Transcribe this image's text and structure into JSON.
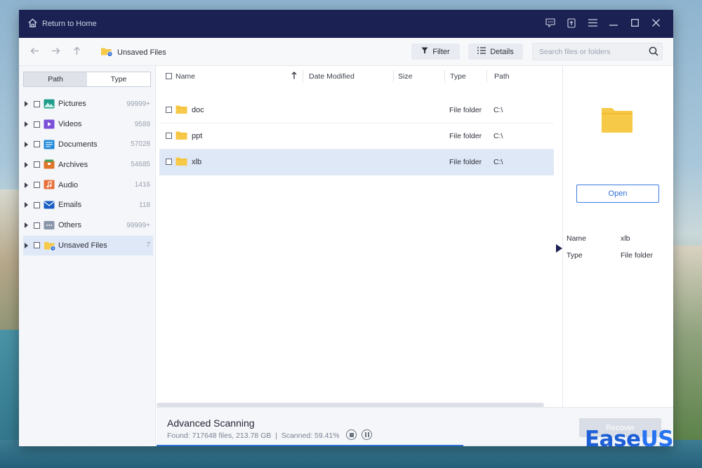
{
  "titlebar": {
    "home_label": "Return to Home"
  },
  "toolbar": {
    "breadcrumb": "Unsaved Files",
    "filter_label": "Filter",
    "details_label": "Details",
    "search_placeholder": "Search files or folders"
  },
  "sidebar": {
    "tabs": [
      {
        "label": "Path",
        "active": true
      },
      {
        "label": "Type",
        "active": false
      }
    ],
    "categories": [
      {
        "label": "Pictures",
        "count": "99999+",
        "icon": "pictures-icon"
      },
      {
        "label": "Videos",
        "count": "9589",
        "icon": "videos-icon"
      },
      {
        "label": "Documents",
        "count": "57028",
        "icon": "documents-icon"
      },
      {
        "label": "Archives",
        "count": "54685",
        "icon": "archives-icon"
      },
      {
        "label": "Audio",
        "count": "1416",
        "icon": "audio-icon"
      },
      {
        "label": "Emails",
        "count": "118",
        "icon": "emails-icon"
      },
      {
        "label": "Others",
        "count": "99999+",
        "icon": "others-icon"
      },
      {
        "label": "Unsaved Files",
        "count": "7",
        "icon": "unsaved-files-icon",
        "selected": true
      }
    ]
  },
  "filelist": {
    "columns": {
      "name": "Name",
      "date": "Date Modified",
      "size": "Size",
      "type": "Type",
      "path": "Path"
    },
    "rows": [
      {
        "name": "doc",
        "type": "File folder",
        "path": "C:\\",
        "selected": false
      },
      {
        "name": "ppt",
        "type": "File folder",
        "path": "C:\\",
        "selected": false
      },
      {
        "name": "xlb",
        "type": "File folder",
        "path": "C:\\",
        "selected": true
      }
    ]
  },
  "details": {
    "open_label": "Open",
    "name_key": "Name",
    "name_value": "xlb",
    "type_key": "Type",
    "type_value": "File folder"
  },
  "status": {
    "title": "Advanced Scanning",
    "found": "Found: 717648 files, 213.78 GB",
    "separator": "|",
    "scanned": "Scanned: 59.41%",
    "progress": 0.5941,
    "recover_label": "Recover"
  },
  "brand": {
    "part1": "Ease",
    "part2": "US"
  },
  "colors": {
    "titlebar": "#1b2152",
    "accent": "#2f6fd6",
    "selection": "#dfe8f7",
    "folder": "#f7c948"
  }
}
